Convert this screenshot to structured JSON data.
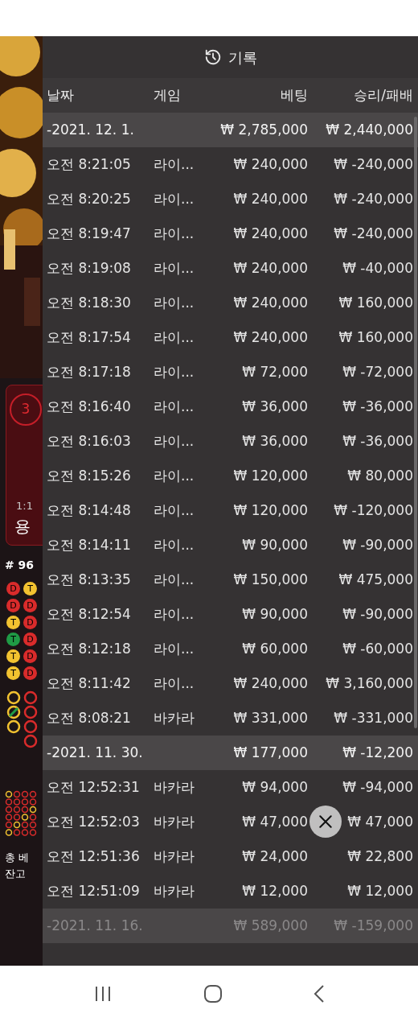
{
  "side_panel": {
    "card": {
      "percent": "3",
      "ratio": "1:1",
      "label": "용"
    },
    "round": "# 96",
    "beads": [
      [
        {
          "text": "D",
          "color": "#d92b2b"
        },
        {
          "text": "T",
          "color": "#f2c230"
        }
      ],
      [
        {
          "text": "D",
          "color": "#d92b2b"
        },
        {
          "text": "D",
          "color": "#d92b2b"
        }
      ],
      [
        {
          "text": "T",
          "color": "#f2c230"
        },
        {
          "text": "D",
          "color": "#d92b2b"
        }
      ],
      [
        {
          "text": "T",
          "color": "#1f9a45"
        },
        {
          "text": "D",
          "color": "#d92b2b"
        }
      ],
      [
        {
          "text": "T",
          "color": "#f2c230"
        },
        {
          "text": "D",
          "color": "#d92b2b"
        }
      ],
      [
        {
          "text": "T",
          "color": "#f2c230"
        },
        {
          "text": "D",
          "color": "#d92b2b"
        }
      ]
    ],
    "total_bet_label": "총 베",
    "balance_label": "잔고"
  },
  "history": {
    "title": "기록",
    "columns": [
      "날짜",
      "게임",
      "베팅",
      "승리/패배"
    ],
    "groups": [
      {
        "date": "-2021. 12. 1.",
        "bet": "₩ 2,785,000",
        "result": "₩ 2,440,000",
        "dimmed": false,
        "rows": [
          {
            "time": "오전 8:21:05",
            "game": "라이...",
            "bet": "₩ 240,000",
            "result": "₩ -240,000"
          },
          {
            "time": "오전 8:20:25",
            "game": "라이...",
            "bet": "₩ 240,000",
            "result": "₩ -240,000"
          },
          {
            "time": "오전 8:19:47",
            "game": "라이...",
            "bet": "₩ 240,000",
            "result": "₩ -240,000"
          },
          {
            "time": "오전 8:19:08",
            "game": "라이...",
            "bet": "₩ 240,000",
            "result": "₩ -40,000"
          },
          {
            "time": "오전 8:18:30",
            "game": "라이...",
            "bet": "₩ 240,000",
            "result": "₩ 160,000"
          },
          {
            "time": "오전 8:17:54",
            "game": "라이...",
            "bet": "₩ 240,000",
            "result": "₩ 160,000"
          },
          {
            "time": "오전 8:17:18",
            "game": "라이...",
            "bet": "₩ 72,000",
            "result": "₩ -72,000"
          },
          {
            "time": "오전 8:16:40",
            "game": "라이...",
            "bet": "₩ 36,000",
            "result": "₩ -36,000"
          },
          {
            "time": "오전 8:16:03",
            "game": "라이...",
            "bet": "₩ 36,000",
            "result": "₩ -36,000"
          },
          {
            "time": "오전 8:15:26",
            "game": "라이...",
            "bet": "₩ 120,000",
            "result": "₩ 80,000"
          },
          {
            "time": "오전 8:14:48",
            "game": "라이...",
            "bet": "₩ 120,000",
            "result": "₩ -120,000"
          },
          {
            "time": "오전 8:14:11",
            "game": "라이...",
            "bet": "₩ 90,000",
            "result": "₩ -90,000"
          },
          {
            "time": "오전 8:13:35",
            "game": "라이...",
            "bet": "₩ 150,000",
            "result": "₩ 475,000"
          },
          {
            "time": "오전 8:12:54",
            "game": "라이...",
            "bet": "₩ 90,000",
            "result": "₩ -90,000"
          },
          {
            "time": "오전 8:12:18",
            "game": "라이...",
            "bet": "₩ 60,000",
            "result": "₩ -60,000"
          },
          {
            "time": "오전 8:11:42",
            "game": "라이...",
            "bet": "₩ 240,000",
            "result": "₩ 3,160,000"
          },
          {
            "time": "오전 8:08:21",
            "game": "바카라",
            "bet": "₩ 331,000",
            "result": "₩ -331,000"
          }
        ]
      },
      {
        "date": "-2021. 11. 30.",
        "bet": "₩ 177,000",
        "result": "₩ -12,200",
        "dimmed": false,
        "rows": [
          {
            "time": "오전 12:52:31",
            "game": "바카라",
            "bet": "₩ 94,000",
            "result": "₩ -94,000"
          },
          {
            "time": "오전 12:52:03",
            "game": "바카라",
            "bet": "₩ 47,000",
            "result": "₩ 47,000"
          },
          {
            "time": "오전 12:51:36",
            "game": "바카라",
            "bet": "₩ 24,000",
            "result": "₩ 22,800"
          },
          {
            "time": "오전 12:51:09",
            "game": "바카라",
            "bet": "₩ 12,000",
            "result": "₩ 12,000"
          }
        ]
      },
      {
        "date": "-2021. 11. 16.",
        "bet": "₩ 589,000",
        "result": "₩ -159,000",
        "dimmed": true
      }
    ]
  }
}
